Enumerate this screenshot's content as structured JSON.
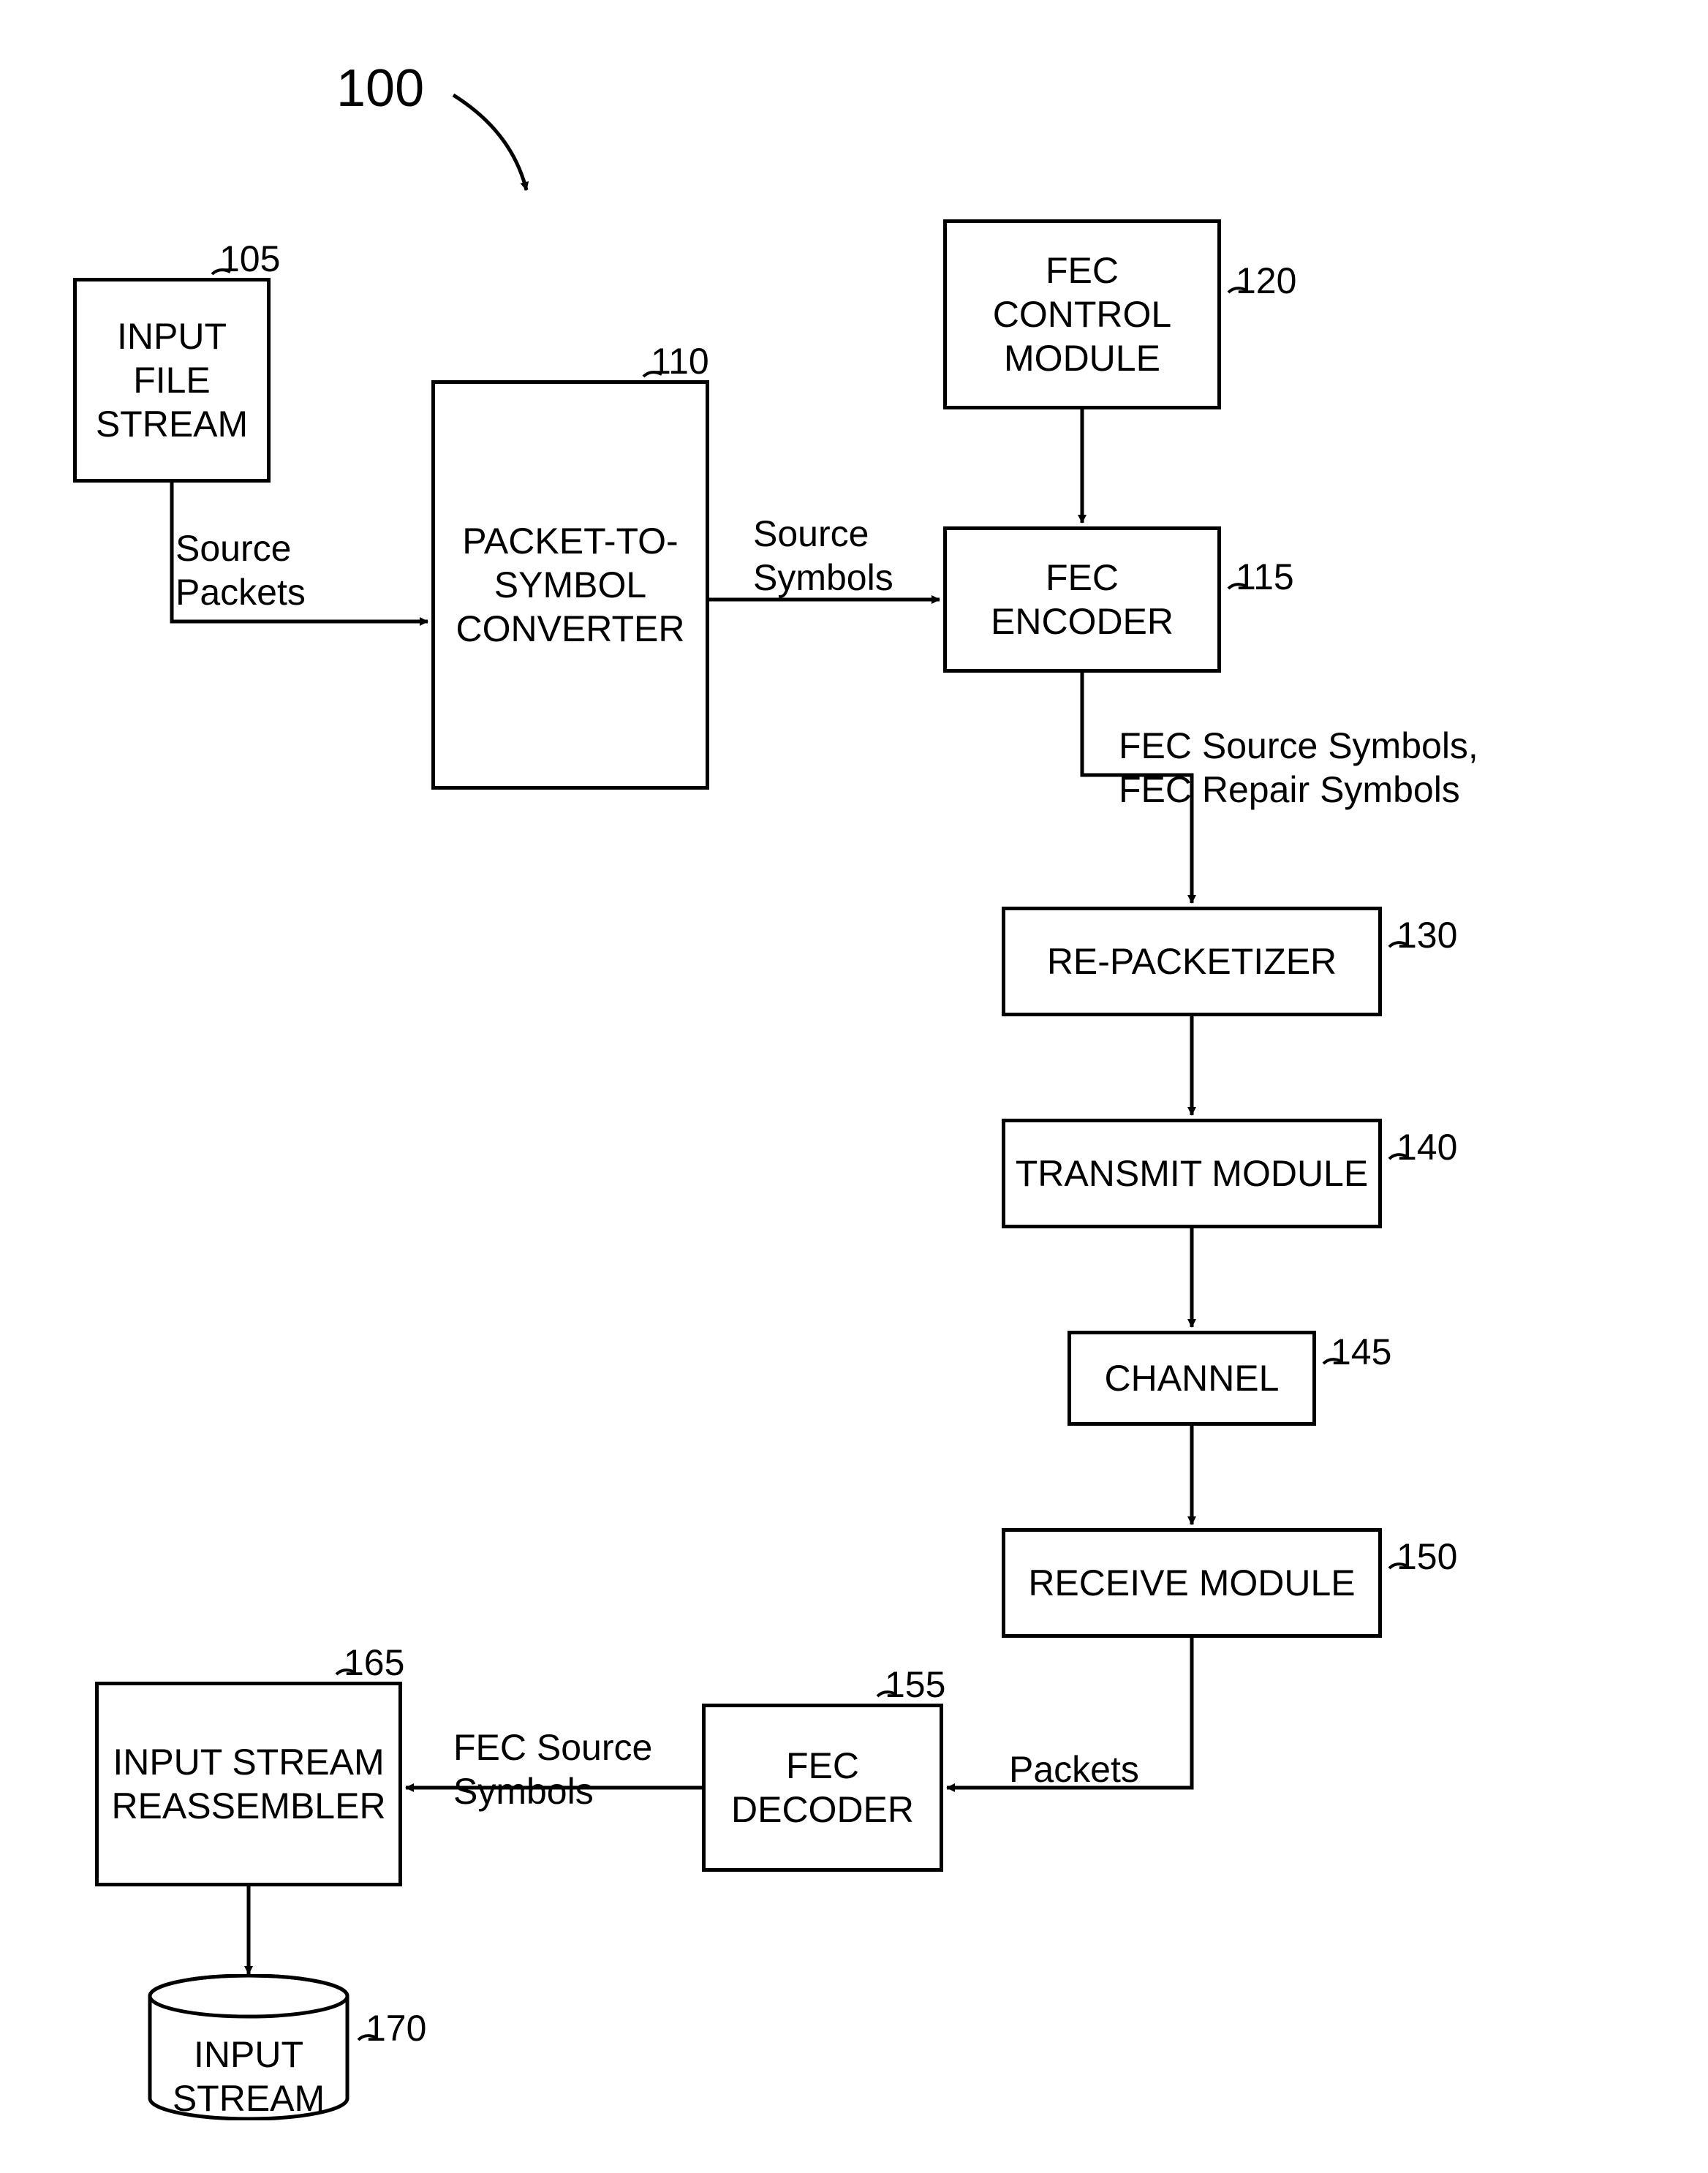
{
  "figure_number": "100",
  "nodes": {
    "input_file_stream": {
      "label": "INPUT\nFILE\nSTREAM",
      "ref": "105"
    },
    "packet_to_symbol": {
      "label": "PACKET-TO-\nSYMBOL\nCONVERTER",
      "ref": "110"
    },
    "fec_encoder": {
      "label": "FEC\nENCODER",
      "ref": "115"
    },
    "fec_control": {
      "label": "FEC\nCONTROL\nMODULE",
      "ref": "120"
    },
    "repacketizer": {
      "label": "RE-PACKETIZER",
      "ref": "130"
    },
    "transmit": {
      "label": "TRANSMIT MODULE",
      "ref": "140"
    },
    "channel": {
      "label": "CHANNEL",
      "ref": "145"
    },
    "receive": {
      "label": "RECEIVE MODULE",
      "ref": "150"
    },
    "fec_decoder": {
      "label": "FEC\nDECODER",
      "ref": "155"
    },
    "reassembler": {
      "label": "INPUT STREAM\nREASSEMBLER",
      "ref": "165"
    },
    "input_stream_store": {
      "label": "INPUT\nSTREAM",
      "ref": "170"
    }
  },
  "edges": {
    "source_packets": "Source\nPackets",
    "source_symbols": "Source\nSymbols",
    "fec_symbols": "FEC Source Symbols,\nFEC Repair Symbols",
    "packets": "Packets",
    "fec_source_symbols": "FEC Source\nSymbols"
  }
}
